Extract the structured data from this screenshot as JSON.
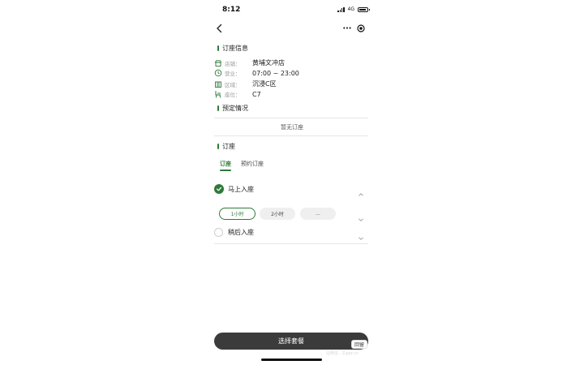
{
  "status_bar": {
    "time": "8:12",
    "network": "4G"
  },
  "nav": {
    "menu_dots": "•••"
  },
  "booking_info": {
    "title": "订座信息",
    "rows": [
      {
        "icon": "store-icon",
        "label": "店铺：",
        "value": "黄埔文冲店"
      },
      {
        "icon": "clock-icon",
        "label": "营业：",
        "value": "07:00 ~ 23:00"
      },
      {
        "icon": "area-icon",
        "label": "区域：",
        "value": "沉浸C区"
      },
      {
        "icon": "seat-icon",
        "label": "座位：",
        "value": "C7"
      }
    ]
  },
  "reservation_status": {
    "title": "预定情况",
    "empty_text": "暂无订座"
  },
  "booking": {
    "title": "订座",
    "tabs": [
      {
        "label": "订座",
        "active": true
      },
      {
        "label": "预约订座",
        "active": false
      }
    ],
    "option_now": {
      "label": "马上入座",
      "selected": true
    },
    "durations": [
      {
        "label": "1小时",
        "selected": true
      },
      {
        "label": "2小时",
        "selected": false
      },
      {
        "label": "...",
        "selected": false
      }
    ],
    "option_later": {
      "label": "稍后入座",
      "selected": false
    }
  },
  "footer": {
    "select_button": "选择套餐",
    "badge": "回留",
    "watermark": "@微信 · Zippr.cn"
  },
  "colors": {
    "accent": "#2f7a3a",
    "button": "#3b3b3b"
  }
}
